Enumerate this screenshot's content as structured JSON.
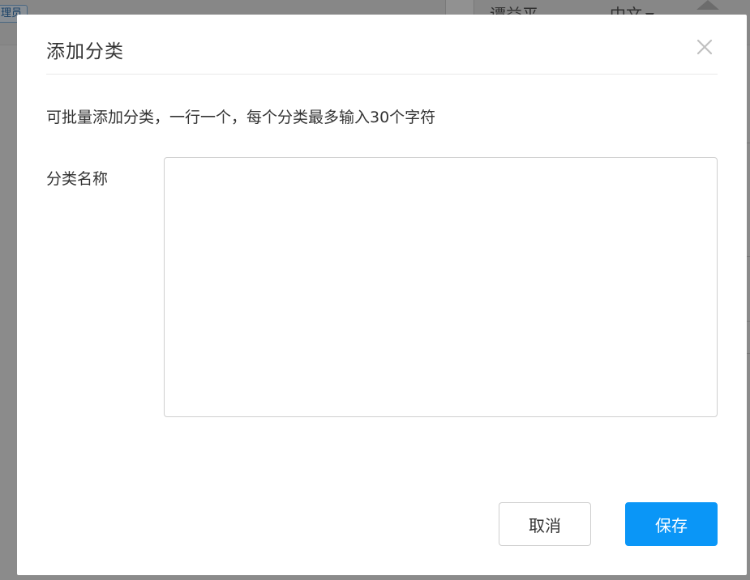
{
  "background": {
    "role_tag": "理员",
    "user_name": "谭益平",
    "language": "中文",
    "language_arrow": "▼"
  },
  "dialog": {
    "title": "添加分类",
    "hint": "可批量添加分类，一行一个，每个分类最多输入30个字符",
    "field_label": "分类名称",
    "textarea_value": "",
    "cancel_label": "取消",
    "save_label": "保存",
    "close_icon": "close-icon"
  },
  "colors": {
    "primary": "#0a96f7",
    "overlay": "rgba(0,0,0,0.42)"
  }
}
